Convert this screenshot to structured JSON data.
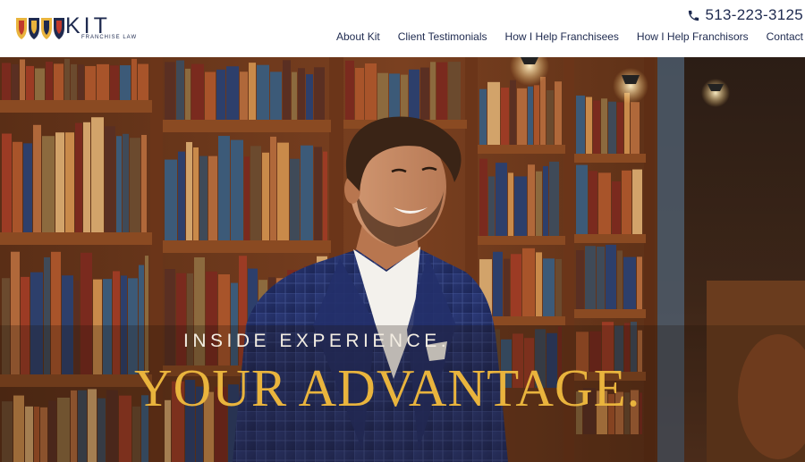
{
  "brand": {
    "wordmark": "KIT",
    "tagline": "FRANCHISE LAW",
    "colors": {
      "navy": "#1e2a4f",
      "gold": "#e9b43d"
    }
  },
  "header": {
    "phone_icon": "phone-icon",
    "phone": "513-223-3125",
    "nav": [
      {
        "label": "About Kit"
      },
      {
        "label": "Client Testimonials"
      },
      {
        "label": "How I Help Franchisees"
      },
      {
        "label": "How I Help Franchisors"
      },
      {
        "label": "Contact"
      }
    ]
  },
  "hero": {
    "line1": "INSIDE EXPERIENCE.",
    "line2": "YOUR ADVANTAGE."
  }
}
